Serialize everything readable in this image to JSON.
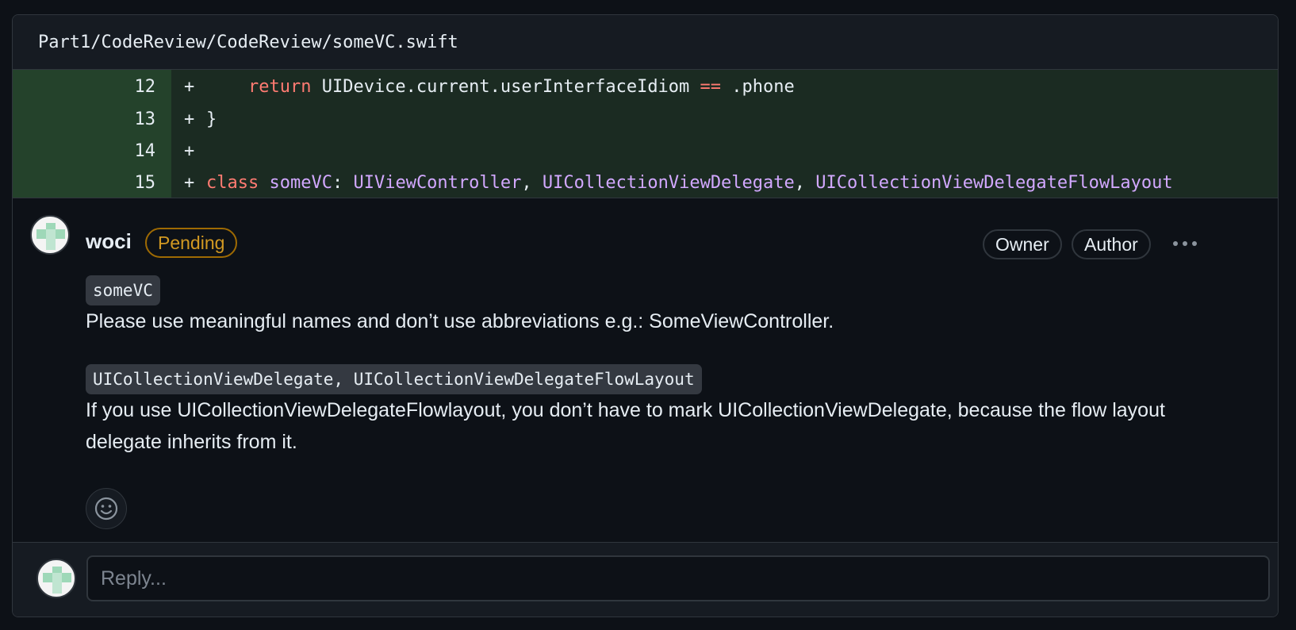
{
  "file": {
    "path": "Part1/CodeReview/CodeReview/someVC.swift"
  },
  "diff": {
    "lines": [
      {
        "number": "12",
        "plus": "+",
        "tokens": [
          {
            "text": "    ",
            "kind": "plain"
          },
          {
            "text": "return",
            "kind": "kw"
          },
          {
            "text": " UIDevice.current.userInterfaceIdiom ",
            "kind": "plain"
          },
          {
            "text": "==",
            "kind": "kw"
          },
          {
            "text": " .phone",
            "kind": "plain"
          }
        ]
      },
      {
        "number": "13",
        "plus": "+",
        "tokens": [
          {
            "text": "}",
            "kind": "plain"
          }
        ]
      },
      {
        "number": "14",
        "plus": "+",
        "tokens": []
      },
      {
        "number": "15",
        "plus": "+",
        "tokens": [
          {
            "text": "class",
            "kind": "kw"
          },
          {
            "text": " ",
            "kind": "plain"
          },
          {
            "text": "someVC",
            "kind": "type"
          },
          {
            "text": ": ",
            "kind": "plain"
          },
          {
            "text": "UIViewController",
            "kind": "type"
          },
          {
            "text": ", ",
            "kind": "plain"
          },
          {
            "text": "UICollectionViewDelegate",
            "kind": "type"
          },
          {
            "text": ", ",
            "kind": "plain"
          },
          {
            "text": "UICollectionViewDelegateFlowLayout",
            "kind": "type"
          }
        ]
      }
    ]
  },
  "comment": {
    "author": "woci",
    "status": "Pending",
    "badges": {
      "owner": "Owner",
      "author": "Author"
    },
    "more_icon": "kebab-horizontal-icon",
    "code_ref_1": "someVC",
    "text_1": "Please use meaningful names and don’t use abbreviations e.g.: SomeViewController.",
    "code_ref_2": "UICollectionViewDelegate, UICollectionViewDelegateFlowLayout",
    "text_2": "If you use UICollectionViewDelegateFlowlayout, you don’t have to mark UICollectionViewDelegate, because the flow layout delegate inherits from it.",
    "reaction_icon": "smiley-icon"
  },
  "reply": {
    "placeholder": "Reply..."
  },
  "colors": {
    "background": "#0d1117",
    "diff_added_bg": "#1b2b22",
    "diff_added_gutter": "#24422b",
    "keyword": "#ff7b72",
    "type": "#d2a8ff",
    "pending": "#d29922"
  }
}
